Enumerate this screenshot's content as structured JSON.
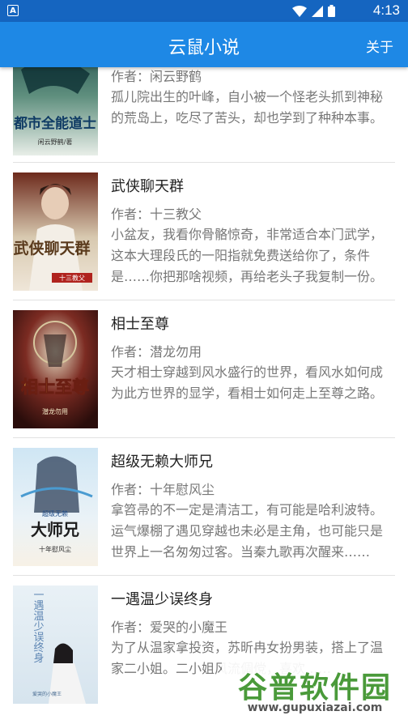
{
  "status_bar": {
    "app_icon_letter": "A",
    "time": "4:13"
  },
  "app_bar": {
    "title": "云鼠小说",
    "about_label": "关于"
  },
  "books": [
    {
      "title": "",
      "author": "作者：闲云野鹤",
      "description": "孤儿院出生的叶峰，自小被一个怪老头抓到神秘的荒岛上，吃尽了苦头，却也学到了种种本事。",
      "cover_text": "都市全能道士",
      "cover_author": "闲云野鹤/著"
    },
    {
      "title": "武侠聊天群",
      "author": "作者：十三教父",
      "description": "小盆友，我看你骨骼惊奇，非常适合本门武学，这本大理段氏的一阳指就免费送给你了，条件是……你把那啥视频，再给老头子我复制一份。",
      "cover_text": "武侠聊天群",
      "cover_author": "十三教父"
    },
    {
      "title": "相士至尊",
      "author": "作者：潜龙勿用",
      "description": "天才相士穿越到风水盛行的世界，看风水如何成为此方世界的显学，看相士如何走上至尊之路。",
      "cover_text": "相士至尊",
      "cover_author": "潜龙勿用"
    },
    {
      "title": "超级无赖大师兄",
      "author": "作者：十年慰风尘",
      "description": "拿笤帚的不一定是清洁工，有可能是哈利波特。运气爆棚了遇见穿越也未必是主角，也可能只是世界上一名匆匆过客。当秦九歌再次醒来……",
      "cover_text": "大师兄",
      "cover_subtext": "超级无赖",
      "cover_author": "十年慰风尘"
    },
    {
      "title": "一遇温少误终身",
      "author": "作者：爱哭的小魔王",
      "description": "为了从温家拿投资，苏昕冉女扮男装，搭上了温家二小姐。二小姐风流倜傥，喜欢……",
      "cover_text": "一遇温少误终身",
      "cover_author": "爱哭的小魔王"
    }
  ],
  "watermark": {
    "text": "谷普软件园",
    "url": "www.gupuxiazai.com"
  }
}
